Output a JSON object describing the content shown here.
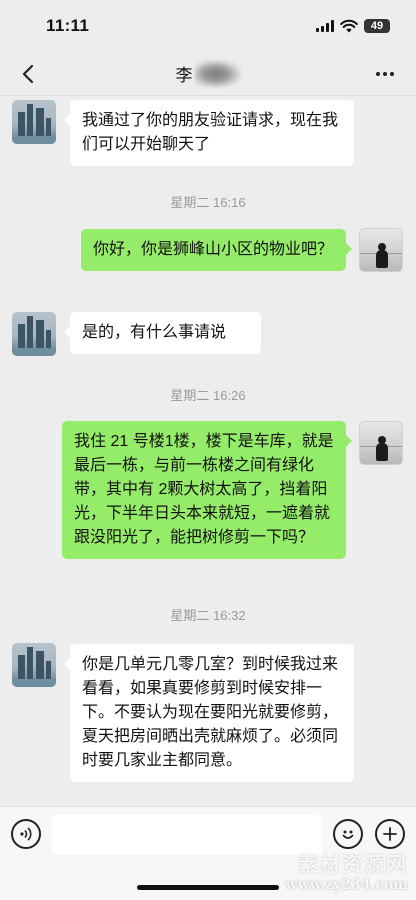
{
  "status_bar": {
    "time": "11:11",
    "battery": "49"
  },
  "header": {
    "title": "李"
  },
  "messages": [
    {
      "side": "left",
      "text": "我通过了你的朋友验证请求，现在我们可以开始聊天了"
    },
    {
      "type": "time",
      "text": "星期二 16:16"
    },
    {
      "side": "right",
      "text": "你好，你是狮峰山小区的物业吧？"
    },
    {
      "side": "left",
      "text": "是的，有什么事请说"
    },
    {
      "type": "time",
      "text": "星期二 16:26"
    },
    {
      "side": "right",
      "text": "我住 21 号楼1楼，楼下是车库，就是最后一栋，与前一栋楼之间有绿化带，其中有 2颗大树太高了，挡着阳光，下半年日头本来就短，一遮着就跟没阳光了，能把树修剪一下吗？"
    },
    {
      "type": "time",
      "text": "星期二 16:32"
    },
    {
      "side": "left",
      "text": "你是几单元几零几室？到时候我过来看看，如果真要修剪到时候安排一下。不要认为现在要阳光就要修剪，夏天把房间晒出壳就麻烦了。必须同时要几家业主都同意。"
    }
  ],
  "input_bar": {
    "value": ""
  },
  "watermark": {
    "text": "素材资源网",
    "url": "www.zy234.com"
  },
  "icons": {
    "back": "chevron-left-icon",
    "more": "more-dots-icon",
    "voice": "voice-icon",
    "emoji": "emoji-icon",
    "add": "plus-icon"
  },
  "colors": {
    "background": "#ededed",
    "incoming_bubble": "#ffffff",
    "outgoing_bubble": "#95ec69",
    "timestamp": "#9a9a9a"
  }
}
